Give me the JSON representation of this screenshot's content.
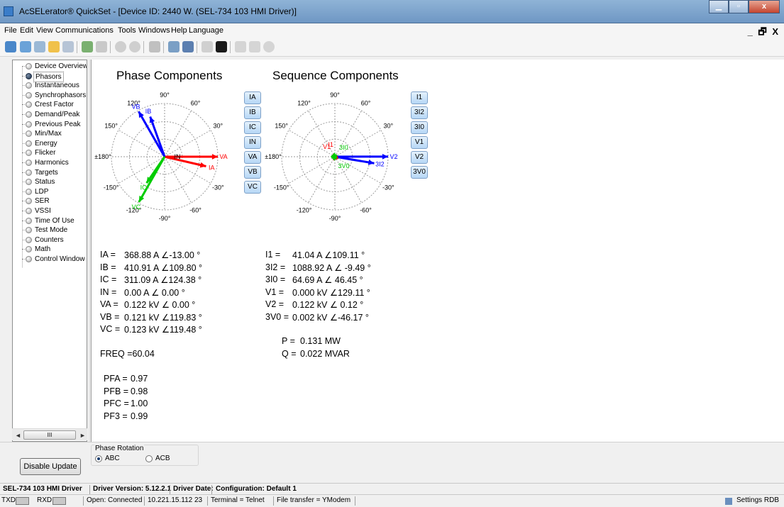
{
  "window": {
    "title": "AcSELerator® QuickSet - [Device ID: 2440 W. (SEL-734 103 HMI Driver)]",
    "minimize": "▁",
    "restore": "▫",
    "close": "x"
  },
  "menu": [
    "File",
    "Edit",
    "View",
    "Communications",
    "Tools",
    "Windows",
    "Help",
    "Language"
  ],
  "mdi_controls": "_ 🗗 X",
  "tree": {
    "items": [
      "Device Overview",
      "Phasors",
      "Instantaneous",
      "Synchrophasors",
      "Crest Factor",
      "Demand/Peak",
      "Previous Peak",
      "Min/Max",
      "Energy",
      "Flicker",
      "Harmonics",
      "Targets",
      "Status",
      "LDP",
      "SER",
      "VSSI",
      "Time Of Use",
      "Test Mode",
      "Counters",
      "Math",
      "Control Window"
    ],
    "selected_index": 1,
    "scroll_thumb": "III"
  },
  "phase": {
    "title": "Phase Components",
    "angle_labels": [
      "90°",
      "60°",
      "30°",
      "±180°",
      "150°",
      "120°",
      "-150°",
      "-120°",
      "-90°",
      "-60°",
      "-30°"
    ],
    "buttons": [
      "IA",
      "IB",
      "IC",
      "IN",
      "VA",
      "VB",
      "VC"
    ],
    "vectors": [
      {
        "name": "VA",
        "angle": 0,
        "mag": 1.0,
        "color": "#ff0000",
        "label": "VA"
      },
      {
        "name": "IA",
        "angle": -13,
        "mag": 0.8,
        "color": "#ff0000",
        "label": "IA"
      },
      {
        "name": "VB",
        "angle": 119.83,
        "mag": 0.98,
        "color": "#0000ff",
        "label": "VB"
      },
      {
        "name": "IB",
        "angle": 109.8,
        "mag": 0.8,
        "color": "#0000ff",
        "label": "IB"
      },
      {
        "name": "VC",
        "angle": -119.48,
        "mag": 0.98,
        "color": "#00cc00",
        "label": "VC"
      },
      {
        "name": "IC",
        "angle": -124.38,
        "mag": 0.6,
        "color": "#00cc00",
        "label": "IC"
      },
      {
        "name": "IN",
        "angle": 0,
        "mag": 0.0,
        "color": "#000000",
        "label": "IN"
      }
    ],
    "measurements": [
      {
        "label": "IA =",
        "value": "368.88 A ∠-13.00 °"
      },
      {
        "label": "IB =",
        "value": "410.91 A ∠109.80 °"
      },
      {
        "label": "IC =",
        "value": "311.09 A ∠124.38 °"
      },
      {
        "label": "IN =",
        "value": "0.00 A ∠  0.00 °"
      },
      {
        "label": "VA =",
        "value": "0.122 kV ∠  0.00 °"
      },
      {
        "label": "VB =",
        "value": "0.121 kV ∠119.83 °"
      },
      {
        "label": "VC =",
        "value": "0.123 kV ∠119.48 °"
      }
    ],
    "freq": "FREQ =60.04",
    "pf": [
      {
        "label": "PFA =",
        "value": "0.97"
      },
      {
        "label": "PFB =",
        "value": "0.98"
      },
      {
        "label": "PFC =",
        "value": "1.00"
      },
      {
        "label": "PF3 =",
        "value": "0.99"
      }
    ]
  },
  "sequence": {
    "title": "Sequence Components",
    "angle_labels": [
      "90°",
      "60°",
      "30°",
      "±180°",
      "150°",
      "120°",
      "-150°",
      "-120°",
      "-90°",
      "-60°",
      "-30°"
    ],
    "buttons": [
      "I1",
      "3I2",
      "3I0",
      "V1",
      "V2",
      "3V0"
    ],
    "vectors": [
      {
        "name": "V2",
        "angle": 0.12,
        "mag": 1.0,
        "color": "#0000ff",
        "label": "V2"
      },
      {
        "name": "3I2",
        "angle": -9.49,
        "mag": 0.75,
        "color": "#0000ff",
        "label": "3I2"
      },
      {
        "name": "I1",
        "angle": 109.11,
        "mag": 0.05,
        "color": "#ff0000",
        "label": "I1"
      },
      {
        "name": "V1",
        "angle": 129.11,
        "mag": 0.06,
        "color": "#ff0000",
        "label": "V1"
      },
      {
        "name": "3I0",
        "angle": 46.45,
        "mag": 0.05,
        "color": "#00cc00",
        "label": "3I0"
      },
      {
        "name": "3V0",
        "angle": -46.17,
        "mag": 0.05,
        "color": "#00cc00",
        "label": "3V0"
      }
    ],
    "measurements": [
      {
        "label": "I1 =",
        "value": "41.04 A ∠109.11 °"
      },
      {
        "label": "3I2 =",
        "value": "1088.92 A ∠ -9.49 °"
      },
      {
        "label": "3I0 =",
        "value": "64.69 A ∠ 46.45 °"
      },
      {
        "label": "V1 =",
        "value": "0.000 kV ∠129.11 °"
      },
      {
        "label": "V2 =",
        "value": "0.122 kV ∠  0.12 °"
      },
      {
        "label": "3V0 =",
        "value": "0.002 kV ∠-46.17 °"
      }
    ],
    "power": [
      {
        "label": "P =",
        "value": "0.131 MW"
      },
      {
        "label": "Q =",
        "value": "0.022 MVAR"
      }
    ]
  },
  "controls": {
    "disable_update": "Disable Update",
    "phase_rotation_label": "Phase Rotation",
    "abc": "ABC",
    "acb": "ACB",
    "selected": "ABC"
  },
  "infobar": {
    "driver": "SEL-734 103 HMI Driver",
    "version": "Driver Version: 5.12.2.1",
    "date": "Driver Date:",
    "config": "Configuration: Default 1"
  },
  "status": {
    "txd": "TXD",
    "rxd": "RXD",
    "connection": "Open: Connected",
    "address": "10.221.15.112  23",
    "terminal": "Terminal = Telnet",
    "transfer": "File transfer = YModem",
    "settings": "Settings RDB"
  }
}
